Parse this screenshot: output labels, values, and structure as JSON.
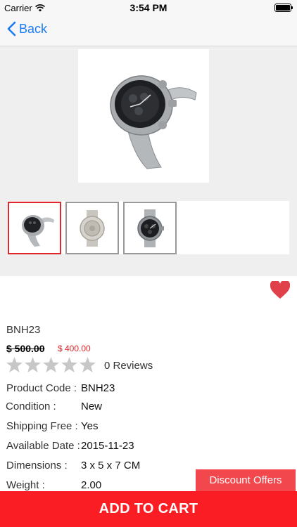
{
  "status": {
    "carrier": "Carrier",
    "time": "3:54 PM",
    "battery_level": 1.0
  },
  "nav": {
    "back_label": "Back",
    "back_icon": "chevron-left-icon"
  },
  "gallery": {
    "thumbnails": [
      {
        "icon": "watch-side-view",
        "selected": true
      },
      {
        "icon": "watch-back-view",
        "selected": false
      },
      {
        "icon": "watch-front-view",
        "selected": false
      }
    ],
    "selected_border_color": "#e0262c"
  },
  "favorite": {
    "icon": "heart-icon",
    "color": "#e0404a"
  },
  "product": {
    "sku": "BNH23",
    "old_price": "$  500.00",
    "new_price": "$ 400.00",
    "rating": 0,
    "rating_max": 5,
    "reviews": "0 Reviews"
  },
  "specs": [
    {
      "label": "Product Code :",
      "value": "BNH23"
    },
    {
      "label": "Condition :",
      "value": "New"
    },
    {
      "label": "Shipping Free :",
      "value": "Yes"
    },
    {
      "label": "Available Date :",
      "value": "2015-11-23"
    },
    {
      "label": "Dimensions :",
      "value": "3 x 5 x 7 CM"
    },
    {
      "label": "Weight :",
      "value": "2.00"
    }
  ],
  "actions": {
    "discount_label": "Discount Offers",
    "cart_label": "ADD TO CART",
    "cart_color": "#fb1d24"
  }
}
